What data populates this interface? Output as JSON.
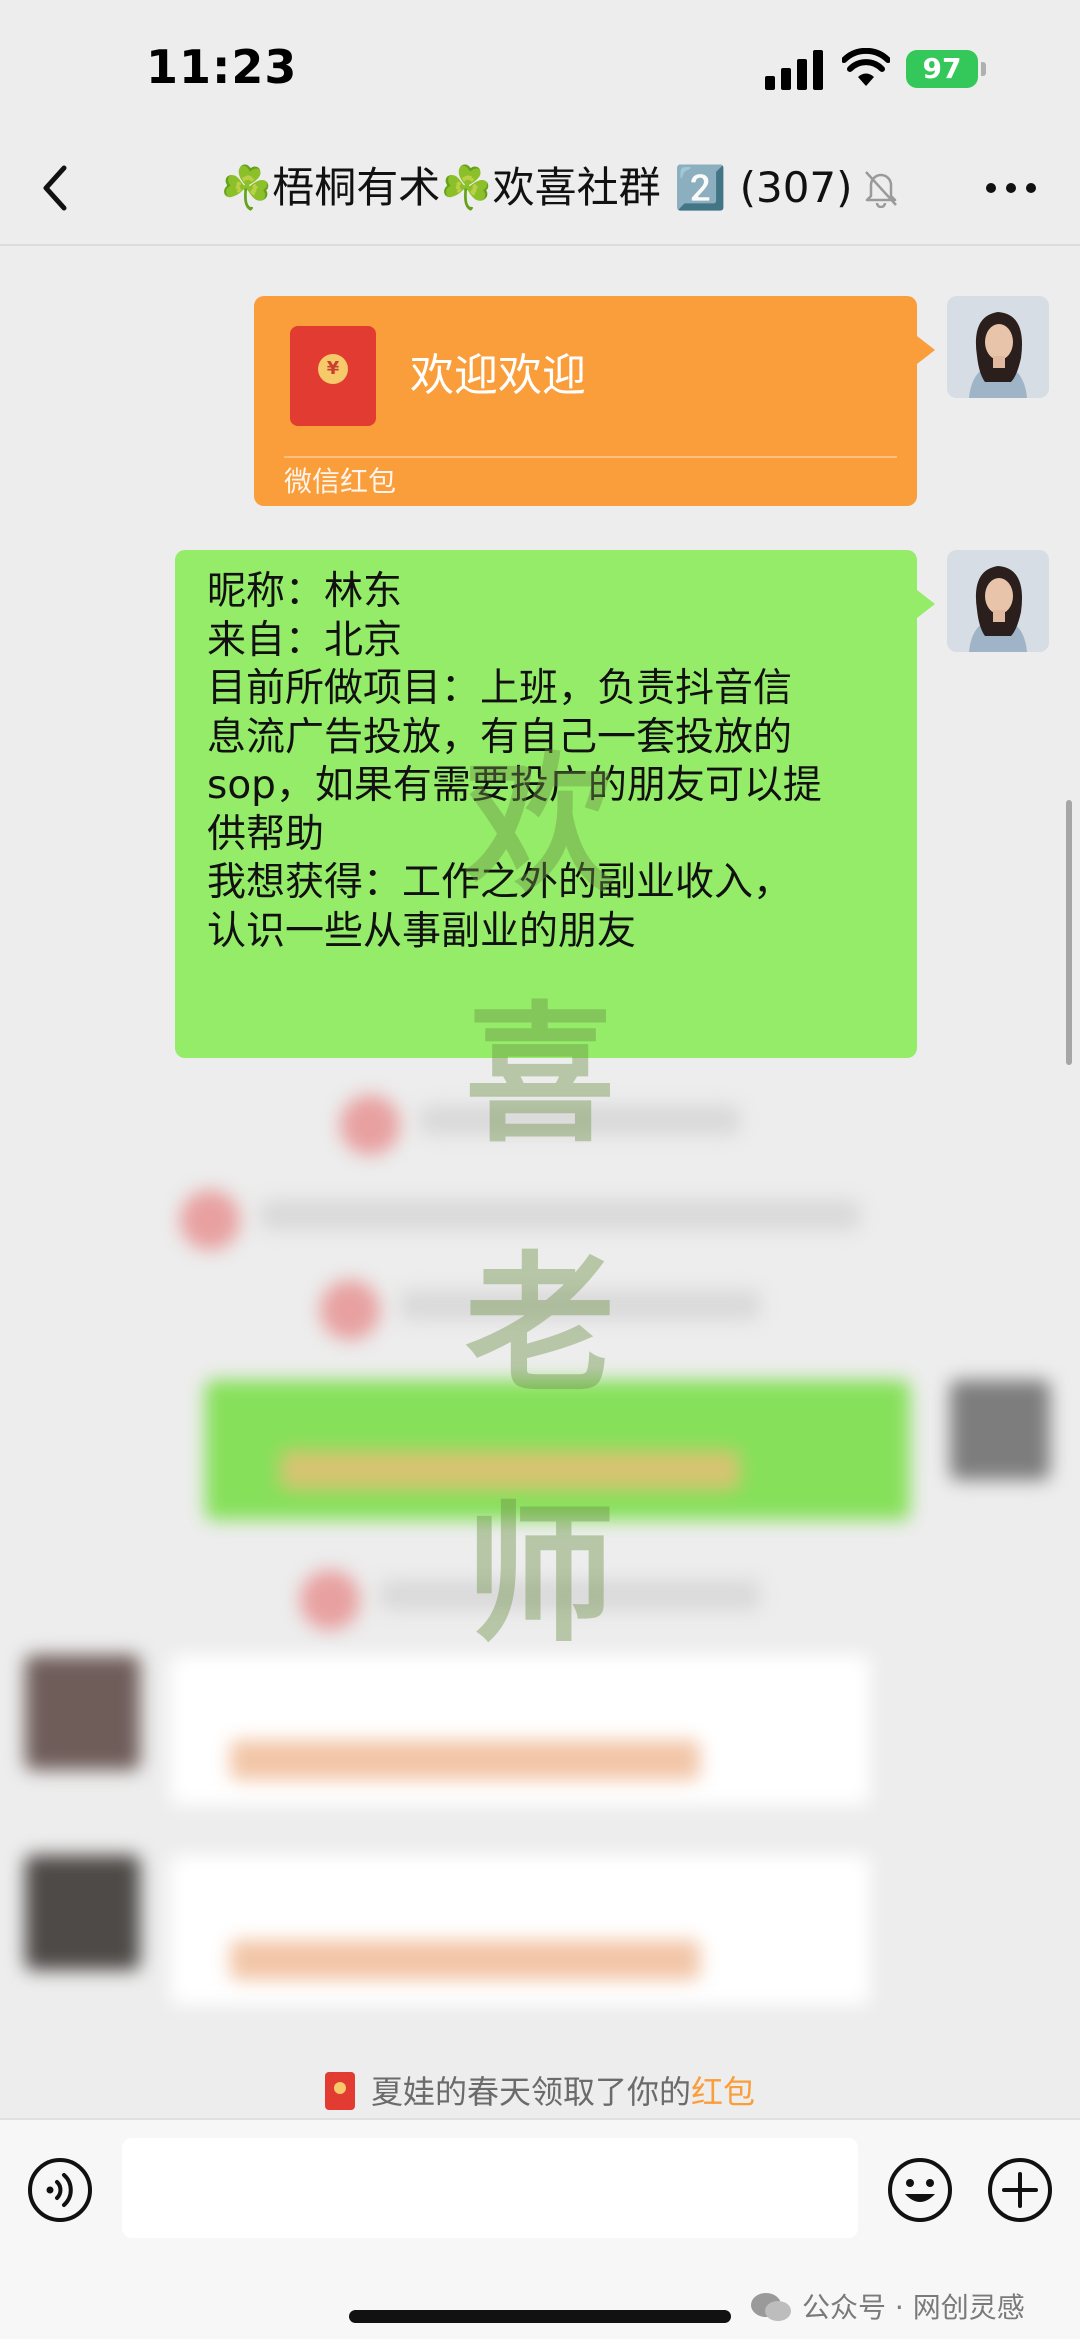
{
  "status_bar": {
    "time": "11:23",
    "battery": "97"
  },
  "nav": {
    "title": "☘️梧桐有术☘️欢喜社群 2️⃣ (307)",
    "back_icon": "chevron-left-icon",
    "mute_icon": "bell-muted-icon",
    "more_icon": "ellipsis-icon"
  },
  "messages": {
    "red_packet": {
      "greeting": "欢迎欢迎",
      "footer": "微信红包",
      "color": "#fa9d3b"
    },
    "intro": {
      "lines": [
        "昵称：林东",
        "来自：北京",
        "目前所做项目：上班，负责抖音信",
        "息流广告投放，有自己一套投放的",
        "sop，如果有需要投广的朋友可以提",
        "供帮助",
        "我想获得：工作之外的副业收入，",
        "认识一些从事副业的朋友"
      ],
      "color": "#95ec69"
    }
  },
  "watermark": [
    "欢",
    "喜",
    "老",
    "师"
  ],
  "system_notice": {
    "prefix": "夏娃的春天领取了你的",
    "link": "红包"
  },
  "input_bar": {
    "placeholder": "",
    "voice_icon": "voice-icon",
    "emoji_icon": "emoji-icon",
    "plus_icon": "plus-icon"
  },
  "source_tag": "公众号 · 网创灵感"
}
